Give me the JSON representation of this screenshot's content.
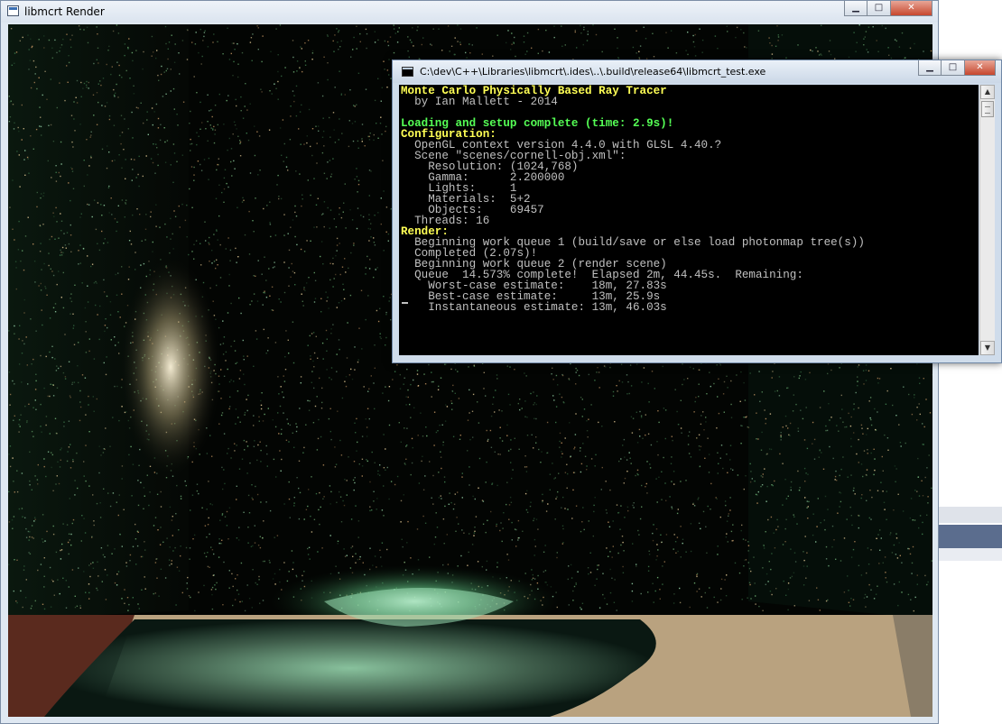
{
  "render_window": {
    "title": "libmcrt Render",
    "controls": {
      "minimize": "▁",
      "maximize": "□",
      "close": "✕"
    }
  },
  "console_window": {
    "title": "C:\\dev\\C++\\Libraries\\libmcrt\\.ides\\..\\.build\\release64\\libmcrt_test.exe",
    "controls": {
      "minimize": "▁",
      "maximize": "□",
      "close": "✕"
    },
    "lines": [
      {
        "text": "Monte Carlo Physically Based Ray Tracer",
        "color": "yellow"
      },
      {
        "text": "  by Ian Mallett - 2014",
        "color": "gray"
      },
      {
        "text": "",
        "color": "gray"
      },
      {
        "text": "Loading and setup complete (time: 2.9s)!",
        "color": "green"
      },
      {
        "text": "Configuration:",
        "color": "yellow"
      },
      {
        "text": "  OpenGL context version 4.4.0 with GLSL 4.40.?",
        "color": "gray"
      },
      {
        "text": "  Scene \"scenes/cornell-obj.xml\":",
        "color": "gray"
      },
      {
        "text": "    Resolution: (1024,768)",
        "color": "gray"
      },
      {
        "text": "    Gamma:      2.200000",
        "color": "gray"
      },
      {
        "text": "    Lights:     1",
        "color": "gray"
      },
      {
        "text": "    Materials:  5+2",
        "color": "gray"
      },
      {
        "text": "    Objects:    69457",
        "color": "gray"
      },
      {
        "text": "  Threads: 16",
        "color": "gray"
      },
      {
        "text": "Render:",
        "color": "yellow"
      },
      {
        "text": "  Beginning work queue 1 (build/save or else load photonmap tree(s))",
        "color": "gray"
      },
      {
        "text": "  Completed (2.07s)!",
        "color": "gray"
      },
      {
        "text": "  Beginning work queue 2 (render scene)",
        "color": "gray"
      },
      {
        "text": "  Queue  14.573% complete!  Elapsed 2m, 44.45s.  Remaining:",
        "color": "gray"
      },
      {
        "text": "    Worst-case estimate:    18m, 27.83s",
        "color": "gray"
      },
      {
        "text": "    Best-case estimate:     13m, 25.9s",
        "color": "gray"
      },
      {
        "text": "    Instantaneous estimate: 13m, 46.03s",
        "color": "gray"
      }
    ]
  },
  "colors": {
    "console_yellow": "#ffff55",
    "console_green": "#55ff55",
    "console_gray": "#c0c0c0",
    "floor": "#b9a27f",
    "left_wall_floor": "#5a2a1e"
  },
  "icons": {
    "render_app_icon": "window-icon",
    "console_app_icon": "cmd-icon"
  }
}
